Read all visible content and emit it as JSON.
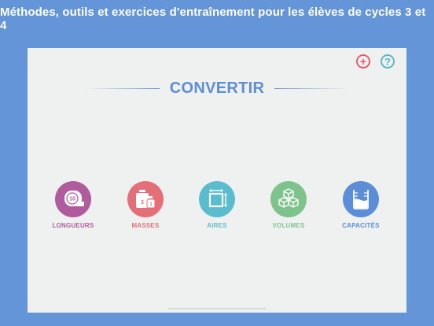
{
  "header": {
    "banner_text": "Méthodes, outils et exercices d'entraînement pour les élèves de cycles 3 et  4"
  },
  "toolbar": {
    "add_icon": "plus-circle-icon",
    "help_icon": "question-circle-icon",
    "add_glyph": "+",
    "help_glyph": "?"
  },
  "title": "CONVERTIR",
  "categories": [
    {
      "label": "LONGUEURS",
      "icon": "tape-measure-icon",
      "icon_text": "10",
      "color": "#b05b9e"
    },
    {
      "label": "MASSES",
      "icon": "weights-icon",
      "icon_text_a": "3",
      "icon_text_b": "1",
      "color": "#e56f78"
    },
    {
      "label": "AIRES",
      "icon": "area-square-icon",
      "color": "#5bbcce"
    },
    {
      "label": "VOLUMES",
      "icon": "cubes-icon",
      "color": "#7dc38b"
    },
    {
      "label": "CAPACITÉS",
      "icon": "beaker-icon",
      "color": "#5b8ed6"
    }
  ],
  "colors": {
    "background": "#6495d9",
    "card": "#eff1f1",
    "title": "#5e8fd0"
  }
}
